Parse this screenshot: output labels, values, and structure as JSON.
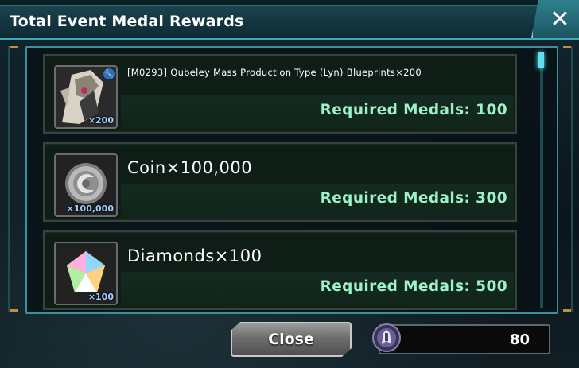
{
  "header": {
    "title": "Total Event Medal Rewards",
    "close_icon": "close-x-icon"
  },
  "rewards": [
    {
      "name": "[M0293]  Qubeley Mass Production Type (Lyn) Blueprints×200",
      "quantity_badge": "×200",
      "required": "Required Medals: 100",
      "icon": "blueprint-icon"
    },
    {
      "name": "Coin×100,000",
      "quantity_badge": "×100,000",
      "required": "Required Medals: 300",
      "icon": "coin-icon"
    },
    {
      "name": "Diamonds×100",
      "quantity_badge": "×100",
      "required": "Required Medals: 500",
      "icon": "diamond-icon"
    }
  ],
  "footer": {
    "close_label": "Close",
    "medal_count": "80",
    "medal_icon": "event-medal-icon"
  },
  "colors": {
    "accent": "#3fa9b8",
    "required_text": "#9ef0c6",
    "header_bg": "#143640"
  }
}
